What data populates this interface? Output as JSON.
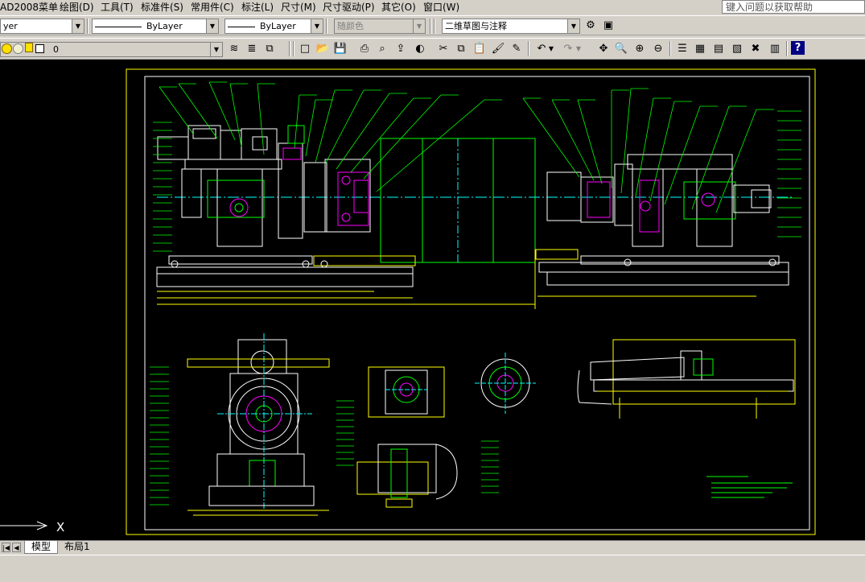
{
  "menu": {
    "items": [
      "AD2008菜单",
      "绘图(D)",
      "工具(T)",
      "标准件(S)",
      "常用件(C)",
      "标注(L)",
      "尺寸(M)",
      "尺寸驱动(P)",
      "其它(O)",
      "窗口(W)"
    ],
    "help_placeholder": "键入问题以获取帮助"
  },
  "toolbar1": {
    "layer_value": "yer",
    "linetype_value": "ByLayer",
    "lineweight_value": "ByLayer",
    "color_value": "随颜色",
    "workspace_value": "二维草图与注释"
  },
  "toolbar2": {
    "layer_state_value": "0"
  },
  "canvas": {
    "ucs_x_label": "X"
  },
  "tabs": {
    "model": "模型",
    "layout1": "布局1"
  },
  "colors": {
    "canvas_bg": "#000000",
    "frame": "#ffff00",
    "part": "#ffffff",
    "leader": "#00ff00",
    "center": "#00ffff",
    "hatch": "#ff00ff",
    "dim": "#ffff00"
  }
}
